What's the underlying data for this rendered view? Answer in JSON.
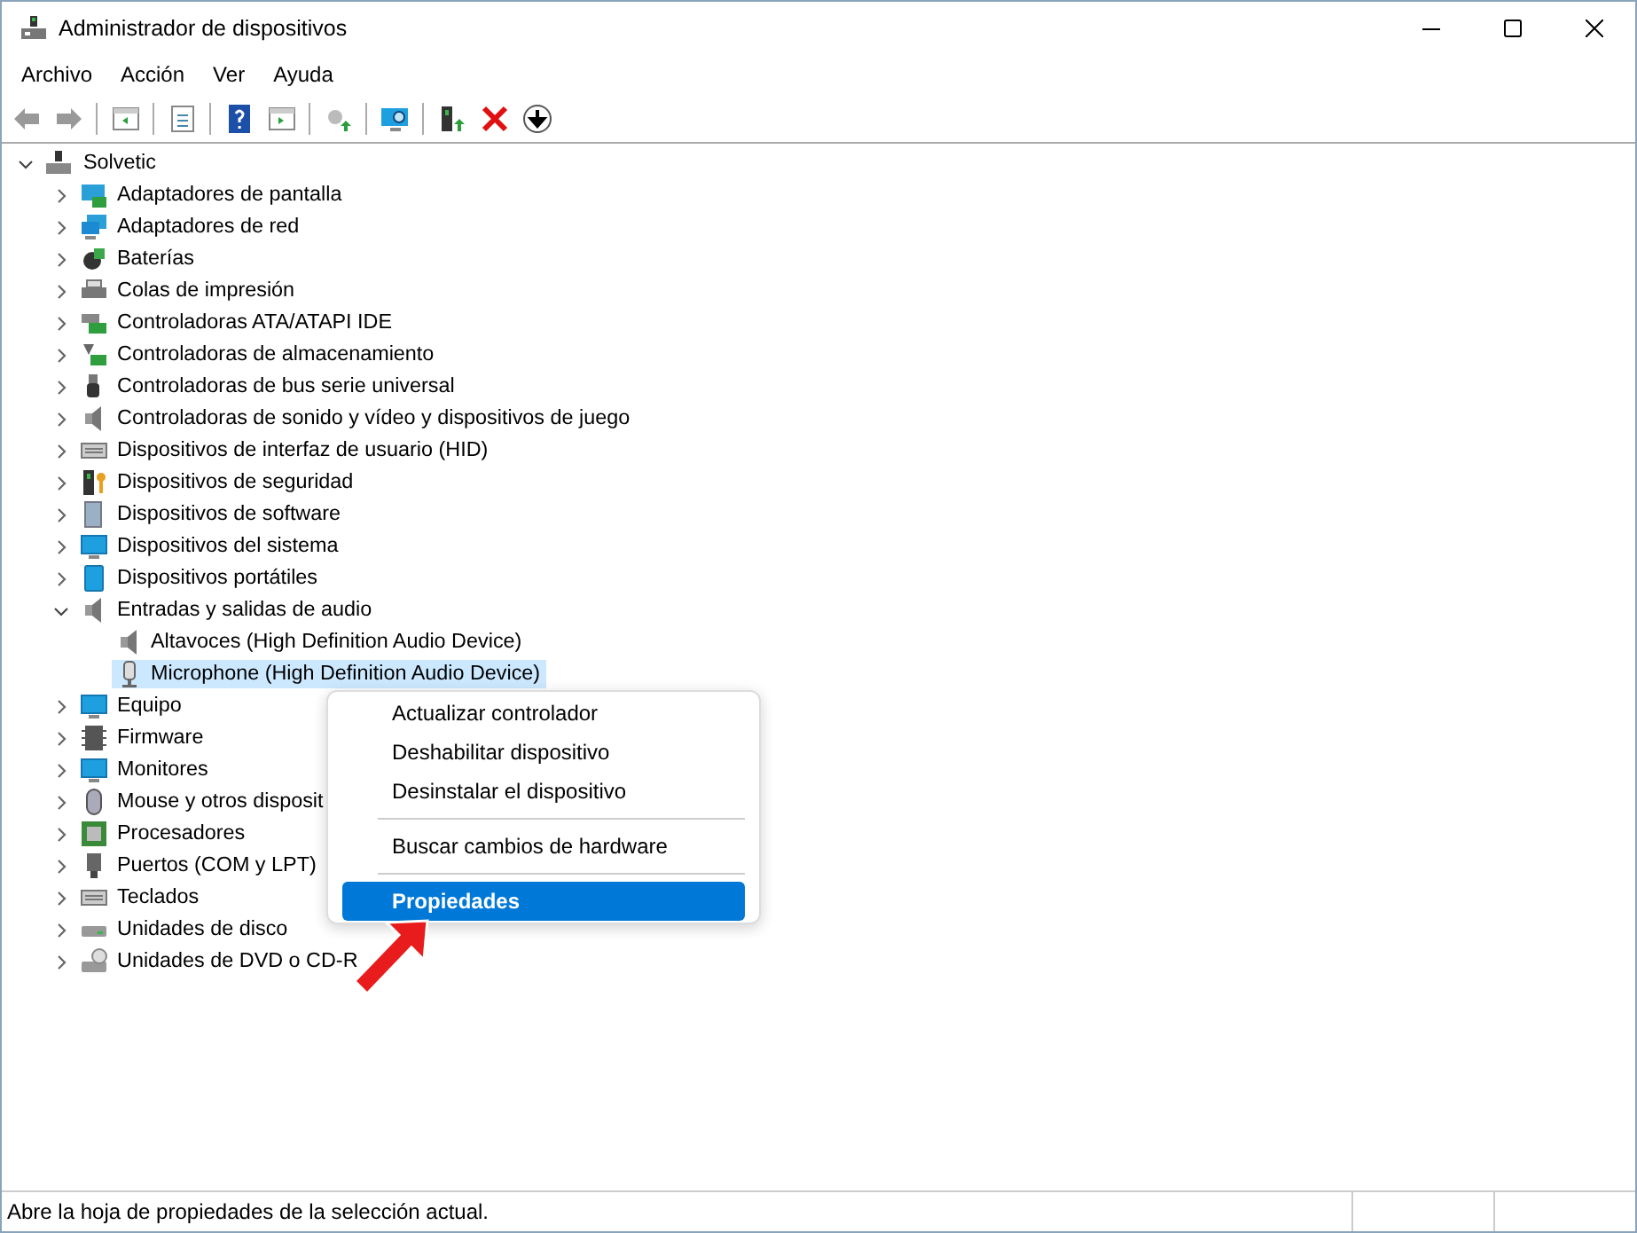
{
  "window": {
    "title": "Administrador de dispositivos"
  },
  "menu_bar": [
    "Archivo",
    "Acción",
    "Ver",
    "Ayuda"
  ],
  "tree": {
    "label": "Solvetic",
    "expanded": true,
    "children": [
      {
        "label": "Adaptadores de pantalla",
        "kind": "display",
        "expanded": false
      },
      {
        "label": "Adaptadores de red",
        "kind": "network",
        "expanded": false
      },
      {
        "label": "Baterías",
        "kind": "battery",
        "expanded": false
      },
      {
        "label": "Colas de impresión",
        "kind": "printer",
        "expanded": false
      },
      {
        "label": "Controladoras ATA/ATAPI IDE",
        "kind": "card",
        "expanded": false
      },
      {
        "label": "Controladoras de almacenamiento",
        "kind": "storage",
        "expanded": false
      },
      {
        "label": "Controladoras de bus serie universal",
        "kind": "usb",
        "expanded": false
      },
      {
        "label": "Controladoras de sonido y vídeo y dispositivos de juego",
        "kind": "speaker",
        "expanded": false
      },
      {
        "label": "Dispositivos de interfaz de usuario (HID)",
        "kind": "keyboard",
        "expanded": false
      },
      {
        "label": "Dispositivos de seguridad",
        "kind": "security",
        "expanded": false
      },
      {
        "label": "Dispositivos de software",
        "kind": "tower",
        "expanded": false
      },
      {
        "label": "Dispositivos del sistema",
        "kind": "monitor",
        "expanded": false
      },
      {
        "label": "Dispositivos portátiles",
        "kind": "tablet",
        "expanded": false
      },
      {
        "label": "Entradas y salidas de audio",
        "kind": "speaker",
        "expanded": true,
        "children": [
          {
            "label": "Altavoces (High Definition Audio Device)",
            "kind": "speaker",
            "selected": false
          },
          {
            "label": "Microphone (High Definition Audio Device)",
            "kind": "mic",
            "selected": true
          }
        ]
      },
      {
        "label": "Equipo",
        "kind": "monitor",
        "expanded": false
      },
      {
        "label": "Firmware",
        "kind": "chip",
        "expanded": false
      },
      {
        "label": "Monitores",
        "kind": "monitor",
        "expanded": false
      },
      {
        "label": "Mouse y otros disposit",
        "kind": "mouse",
        "expanded": false
      },
      {
        "label": "Procesadores",
        "kind": "cpu",
        "expanded": false
      },
      {
        "label": "Puertos (COM y LPT)",
        "kind": "port",
        "expanded": false
      },
      {
        "label": "Teclados",
        "kind": "keyboard",
        "expanded": false
      },
      {
        "label": "Unidades de disco",
        "kind": "disk",
        "expanded": false
      },
      {
        "label": "Unidades de DVD o CD-R",
        "kind": "dvd",
        "expanded": false
      }
    ]
  },
  "context_menu": [
    {
      "kind": "item",
      "label": "Actualizar controlador",
      "selected": false
    },
    {
      "kind": "item",
      "label": "Deshabilitar dispositivo",
      "selected": false
    },
    {
      "kind": "item",
      "label": "Desinstalar el dispositivo",
      "selected": false
    },
    {
      "kind": "separator"
    },
    {
      "kind": "item",
      "label": "Buscar cambios de hardware",
      "selected": false
    },
    {
      "kind": "separator"
    },
    {
      "kind": "item",
      "label": "Propiedades",
      "selected": true
    }
  ],
  "status_bar": {
    "text": "Abre la hoja de propiedades de la selección actual."
  }
}
